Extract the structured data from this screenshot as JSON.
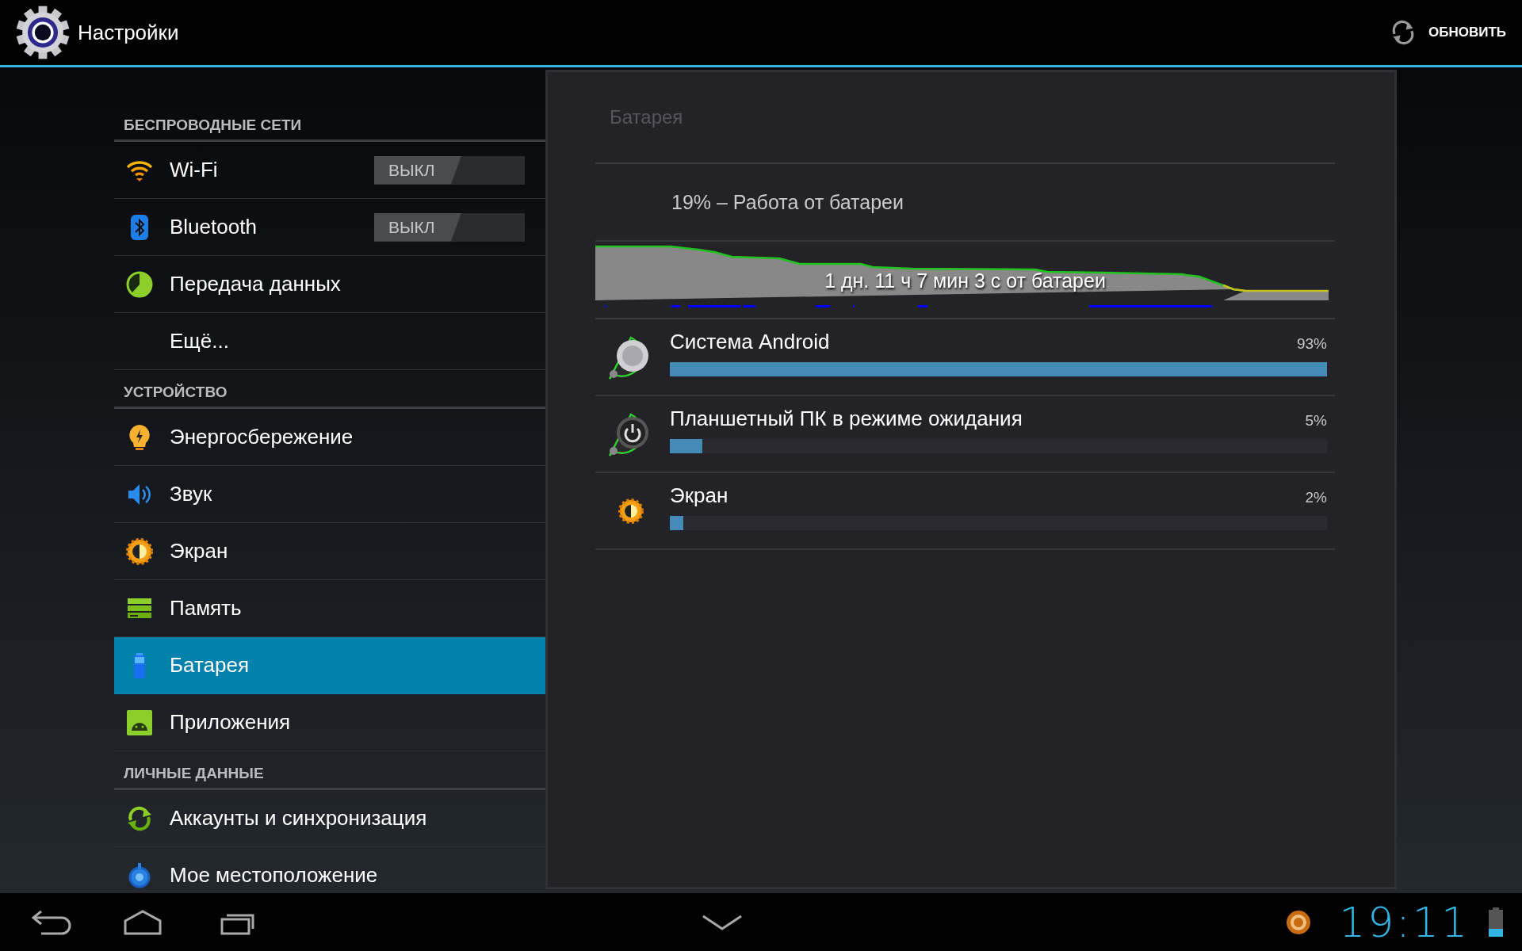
{
  "action_bar": {
    "title": "Настройки",
    "action": "ОБНОВИТЬ"
  },
  "sidebar": {
    "sections": [
      {
        "header": "БЕСПРОВОДНЫЕ СЕТИ",
        "items": [
          {
            "label": "Wi-Fi",
            "kind": "switch",
            "on": false,
            "switch_label": "ВЫКЛ",
            "selected": false
          },
          {
            "label": "Bluetooth",
            "kind": "switch",
            "on": false,
            "switch_label": "ВЫКЛ",
            "selected": false
          },
          {
            "label": "Передача данных",
            "kind": "plain",
            "selected": false
          },
          {
            "label": "Ещё...",
            "kind": "plain",
            "selected": false
          }
        ]
      },
      {
        "header": "УСТРОЙСТВО",
        "items": [
          {
            "label": "Энергосбережение",
            "kind": "plain",
            "selected": false
          },
          {
            "label": "Звук",
            "kind": "plain",
            "selected": false
          },
          {
            "label": "Экран",
            "kind": "plain",
            "selected": false
          },
          {
            "label": "Память",
            "kind": "plain",
            "selected": false
          },
          {
            "label": "Батарея",
            "kind": "plain",
            "selected": true
          },
          {
            "label": "Приложения",
            "kind": "plain",
            "selected": false
          }
        ]
      },
      {
        "header": "ЛИЧНЫЕ ДАННЫЕ",
        "items": [
          {
            "label": "Аккаунты и синхронизация",
            "kind": "plain",
            "selected": false
          },
          {
            "label": "Мое местоположение",
            "kind": "plain",
            "selected": false
          }
        ]
      }
    ]
  },
  "panel": {
    "title": "Батарея",
    "summary": "19% – Работа от батареи",
    "graph_label": "1 дн. 11 ч 7 мин 3 с от батареи",
    "usage": [
      {
        "name": "Система Android",
        "percent": "93%",
        "level": 1.0
      },
      {
        "name": "Планшетный ПК в режиме ожидания",
        "percent": "5%",
        "level": 0.05
      },
      {
        "name": "Экран",
        "percent": "2%",
        "level": 0.02
      }
    ]
  },
  "nav_bar": {
    "clock": "19:11"
  }
}
